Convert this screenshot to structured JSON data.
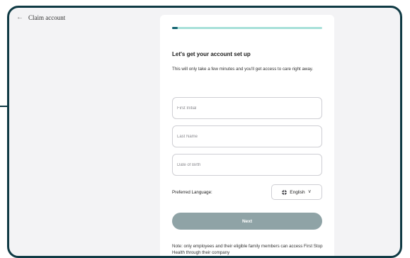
{
  "header": {
    "back_icon": "←",
    "title": "Claim account"
  },
  "progress": {
    "fraction": 0.04
  },
  "form": {
    "heading": "Let's get your account set up",
    "subtext": "This will only take a few minutes and you'll get access to care right away.",
    "first_initial_placeholder": "First Initial",
    "last_name_placeholder": "Last Name",
    "dob_placeholder": "Date of Birth",
    "language_label": "Preferred Language:",
    "language_value": "English",
    "language_chevron": "∨",
    "next_label": "Next",
    "note": "Note: only employees and their eligible family members can access First Stop Health through their company"
  },
  "colors": {
    "progress_fill": "#116270",
    "progress_track": "#a7e0d9",
    "next_button": "#8fa3a6",
    "frame": "#0f3a44"
  }
}
